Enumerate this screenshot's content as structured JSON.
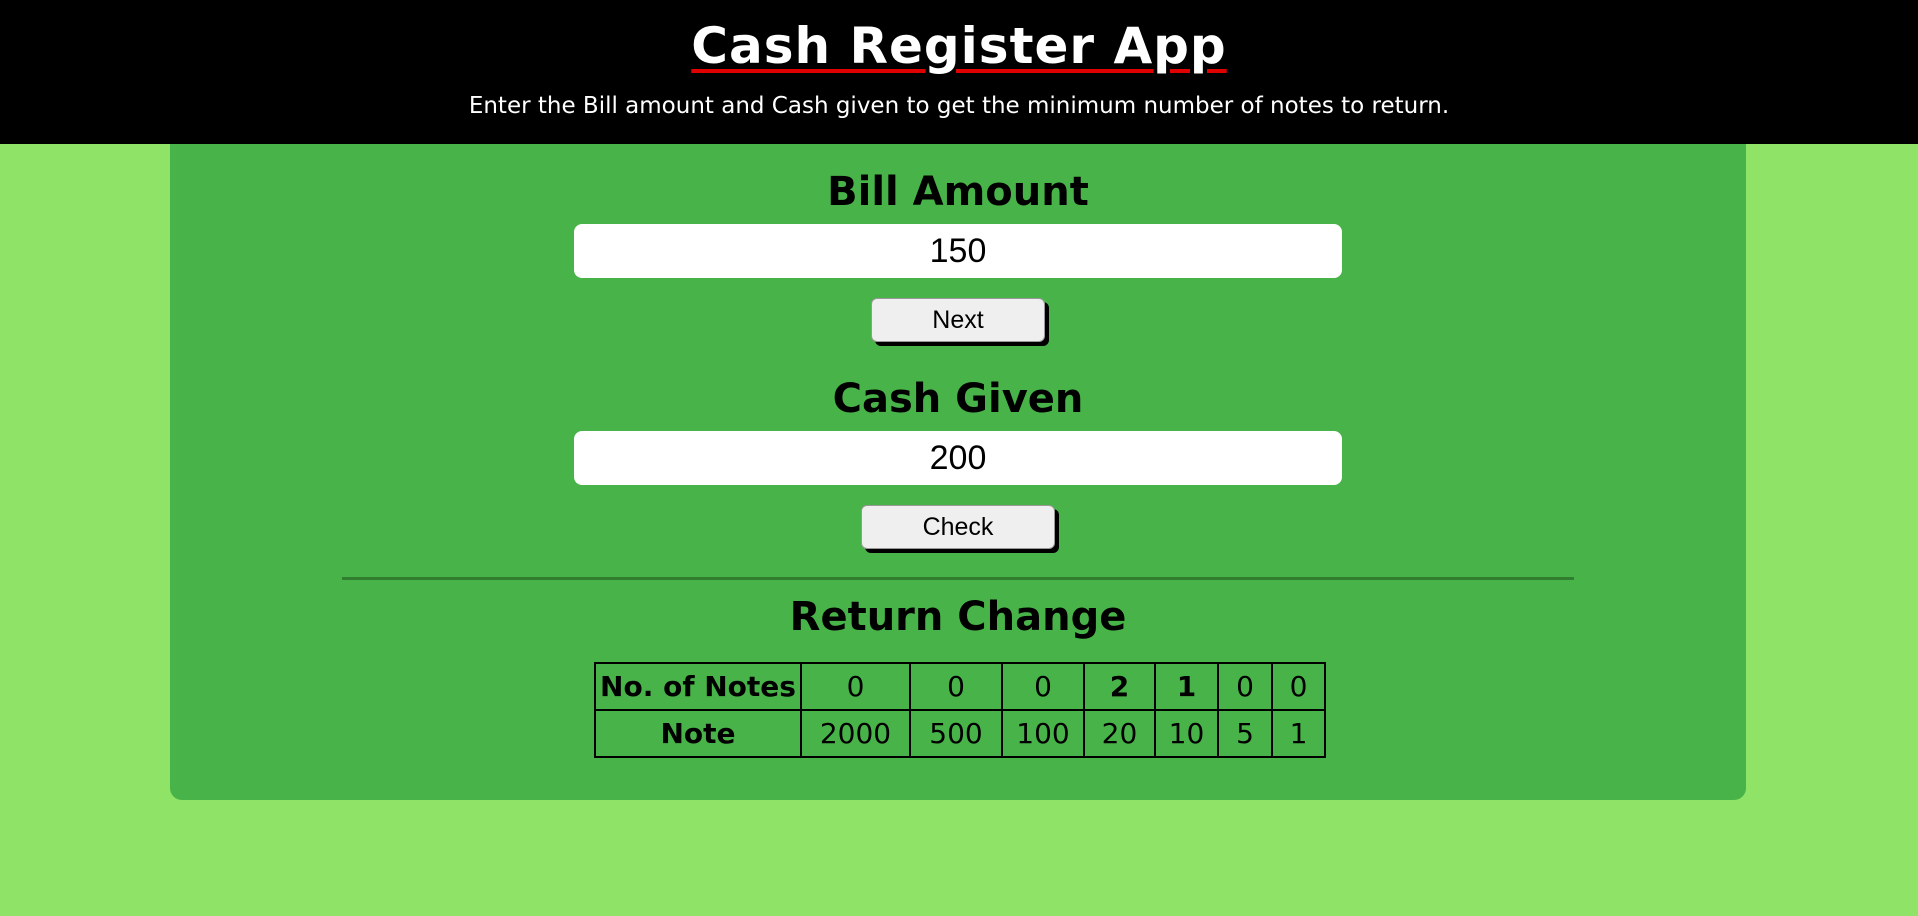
{
  "header": {
    "title": "Cash Register App",
    "subtitle": "Enter the Bill amount and Cash given to get the minimum number of notes to return."
  },
  "bill": {
    "label": "Bill Amount",
    "value": "150",
    "button_label": "Next"
  },
  "cash": {
    "label": "Cash Given",
    "value": "200",
    "button_label": "Check"
  },
  "result": {
    "heading": "Return Change",
    "row_labels": {
      "notes_count": "No. of Notes",
      "note": "Note"
    },
    "counts": [
      "0",
      "0",
      "0",
      "2",
      "1",
      "0",
      "0"
    ],
    "notes": [
      "2000",
      "500",
      "100",
      "20",
      "10",
      "5",
      "1"
    ]
  },
  "colors": {
    "page_background": "#8fe366",
    "card_background": "#48b348",
    "header_background": "#000000",
    "title_underline": "#e00000"
  }
}
